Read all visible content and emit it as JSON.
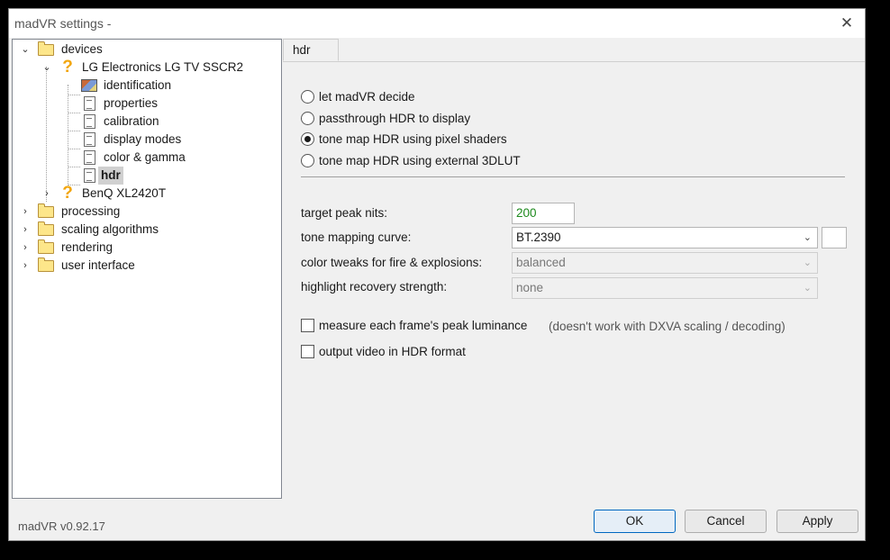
{
  "window": {
    "title": "madVR settings -",
    "close_glyph": "✕",
    "version": "madVR v0.92.17"
  },
  "tree": {
    "items": [
      {
        "label": "devices",
        "icon": "folder-icon",
        "expanded": true
      },
      {
        "label": "LG Electronics LG TV SSCR2",
        "icon": "question-icon",
        "expanded": true
      },
      {
        "label": "identification",
        "icon": "image-icon"
      },
      {
        "label": "properties",
        "icon": "page-icon"
      },
      {
        "label": "calibration",
        "icon": "page-icon"
      },
      {
        "label": "display modes",
        "icon": "page-icon"
      },
      {
        "label": "color & gamma",
        "icon": "page-icon"
      },
      {
        "label": "hdr",
        "icon": "page-icon",
        "selected": true
      },
      {
        "label": "BenQ XL2420T",
        "icon": "question-icon",
        "expanded": false
      },
      {
        "label": "processing",
        "icon": "folder-icon",
        "expanded": false
      },
      {
        "label": "scaling algorithms",
        "icon": "folder-icon",
        "expanded": false
      },
      {
        "label": "rendering",
        "icon": "folder-icon",
        "expanded": false
      },
      {
        "label": "user interface",
        "icon": "folder-icon",
        "expanded": false
      }
    ]
  },
  "panel": {
    "tab": "hdr",
    "radios": [
      {
        "label": "let madVR decide",
        "checked": false
      },
      {
        "label": "passthrough HDR to display",
        "checked": false
      },
      {
        "label": "tone map HDR using pixel shaders",
        "checked": true
      },
      {
        "label": "tone map HDR using external 3DLUT",
        "checked": false
      }
    ],
    "fields": {
      "target_peak_nits": {
        "label": "target peak nits:",
        "value": "200"
      },
      "tone_mapping_curve": {
        "label": "tone mapping curve:",
        "value": "BT.2390"
      },
      "color_tweaks": {
        "label": "color tweaks for fire & explosions:",
        "value": "balanced"
      },
      "highlight_recovery": {
        "label": "highlight recovery strength:",
        "value": "none"
      }
    },
    "checks": [
      {
        "label": "measure each frame's peak luminance",
        "checked": false
      },
      {
        "label": "output video in HDR format",
        "checked": false
      }
    ],
    "note": "(doesn't work with DXVA scaling / decoding)"
  },
  "buttons": {
    "ok": "OK",
    "cancel": "Cancel",
    "apply": "Apply"
  },
  "colors": {
    "accent": "#0067c0",
    "value_green": "#1d8a1d",
    "question_orange": "#f2a60d"
  }
}
